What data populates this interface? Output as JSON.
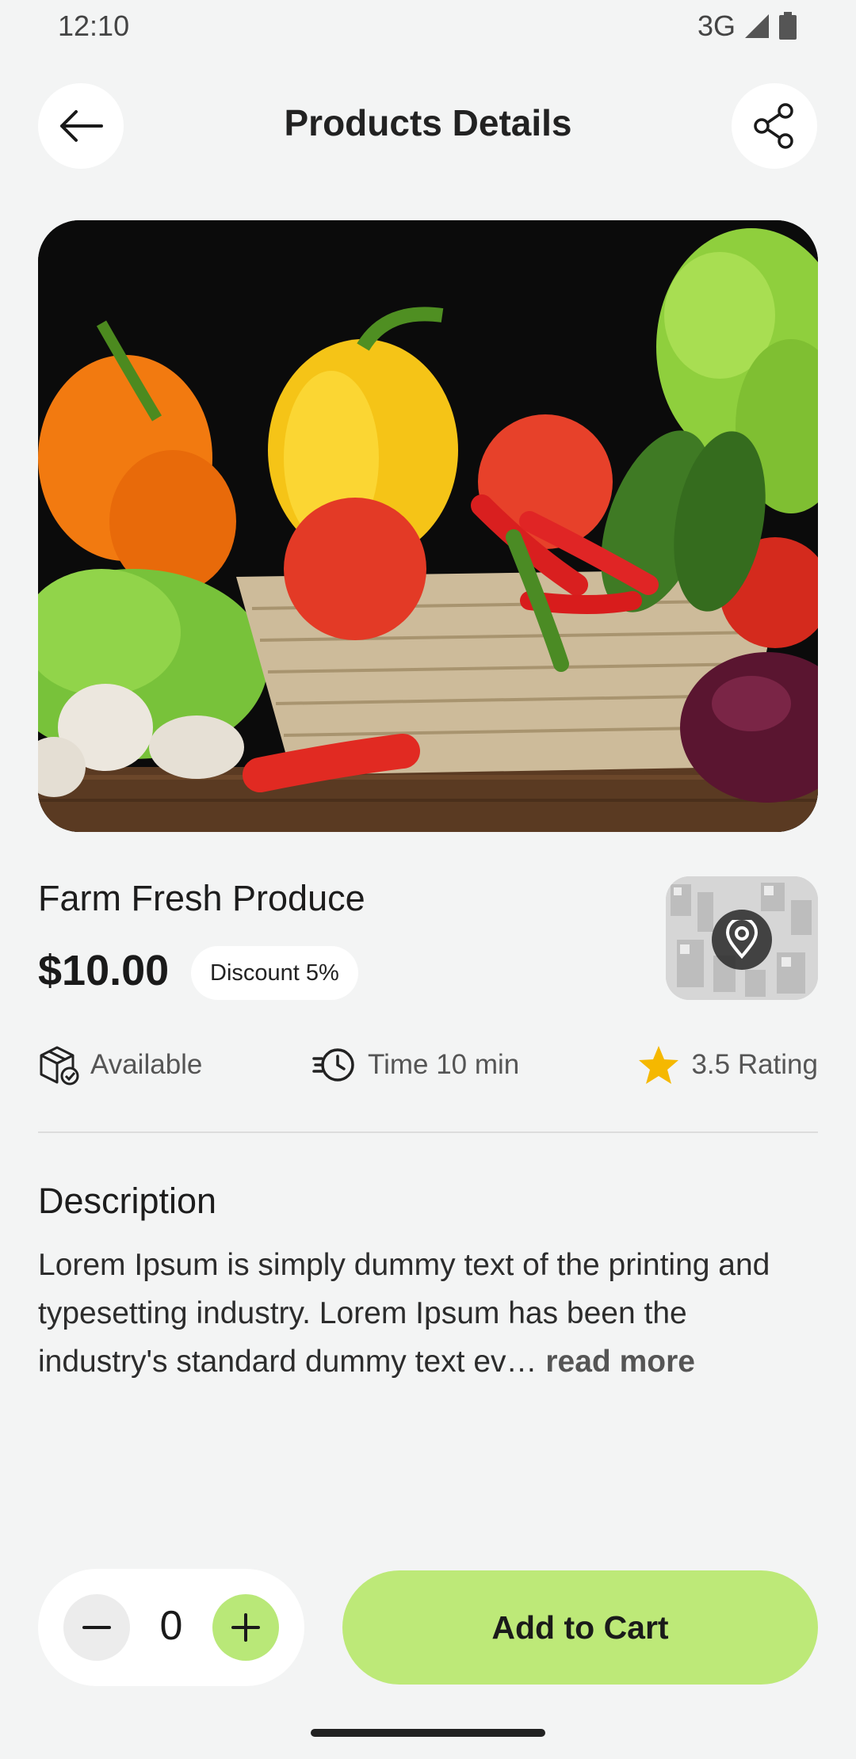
{
  "status_bar": {
    "time": "12:10",
    "network": "3G"
  },
  "header": {
    "title": "Products Details",
    "back_icon": "arrow-left-icon",
    "share_icon": "share-icon"
  },
  "product": {
    "name": "Farm Fresh Produce",
    "price": "$10.00",
    "discount": "Discount 5%",
    "availability": "Available",
    "time": "Time 10 min",
    "rating": "3.5 Rating"
  },
  "description": {
    "title": "Description",
    "text": "Lorem Ipsum is simply dummy text of the printing and typesetting industry. Lorem Ipsum has been the industry's standard dummy text ev… ",
    "read_more": "read more"
  },
  "cart": {
    "quantity": "0",
    "add_label": "Add to Cart"
  },
  "colors": {
    "accent": "#bde978",
    "background": "#f3f4f4",
    "star": "#f5b800"
  }
}
